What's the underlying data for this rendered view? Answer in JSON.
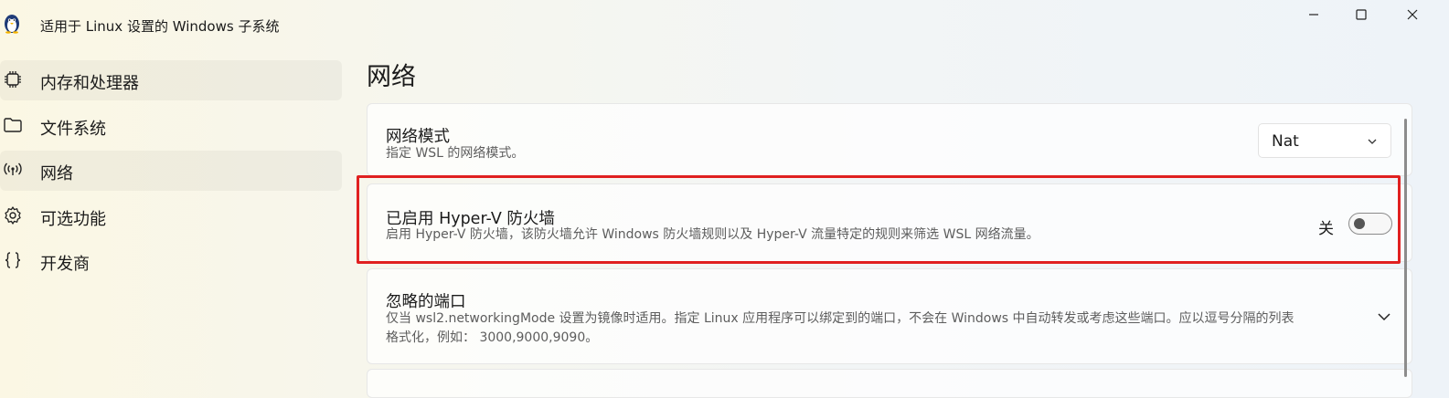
{
  "window": {
    "title": "适用于 Linux 设置的 Windows 子系统",
    "app_icon": "tux-penguin-icon",
    "controls": [
      "minimize-icon",
      "maximize-icon",
      "close-icon"
    ]
  },
  "sidebar": {
    "items": [
      {
        "label": "内存和处理器",
        "icon": "cpu-chip-icon"
      },
      {
        "label": "文件系统",
        "icon": "folder-icon"
      },
      {
        "label": "网络",
        "icon": "network-antenna-icon"
      },
      {
        "label": "可选功能",
        "icon": "gear-icon"
      },
      {
        "label": "开发商",
        "icon": "curly-braces-icon"
      }
    ]
  },
  "main": {
    "title": "网络",
    "settings": [
      {
        "title": "网络模式",
        "description": "指定 WSL 的网络模式。",
        "control": "dropdown",
        "value": "Nat"
      },
      {
        "title": "已启用 Hyper-V 防火墙",
        "description": "启用 Hyper-V 防火墙，该防火墙允许 Windows 防火墙规则以及 Hyper-V 流量特定的规则来筛选 WSL 网络流量。",
        "control": "toggle",
        "state_label": "关",
        "on": false
      },
      {
        "title": "忽略的端口",
        "description_line1": "仅当 wsl2.networkingMode 设置为镜像时适用。指定 Linux 应用程序可以绑定到的端口，不会在 Windows 中自动转发或考虑这些端口。应以逗号分隔的列表",
        "description_line2": "格式化，例如： 3000,9000,9090。",
        "control": "expander"
      }
    ]
  },
  "colors": {
    "highlight_border": "#e02020",
    "card_background": "#ffffff",
    "text_primary": "#1b1b1b",
    "text_secondary": "#5d5d5d"
  }
}
